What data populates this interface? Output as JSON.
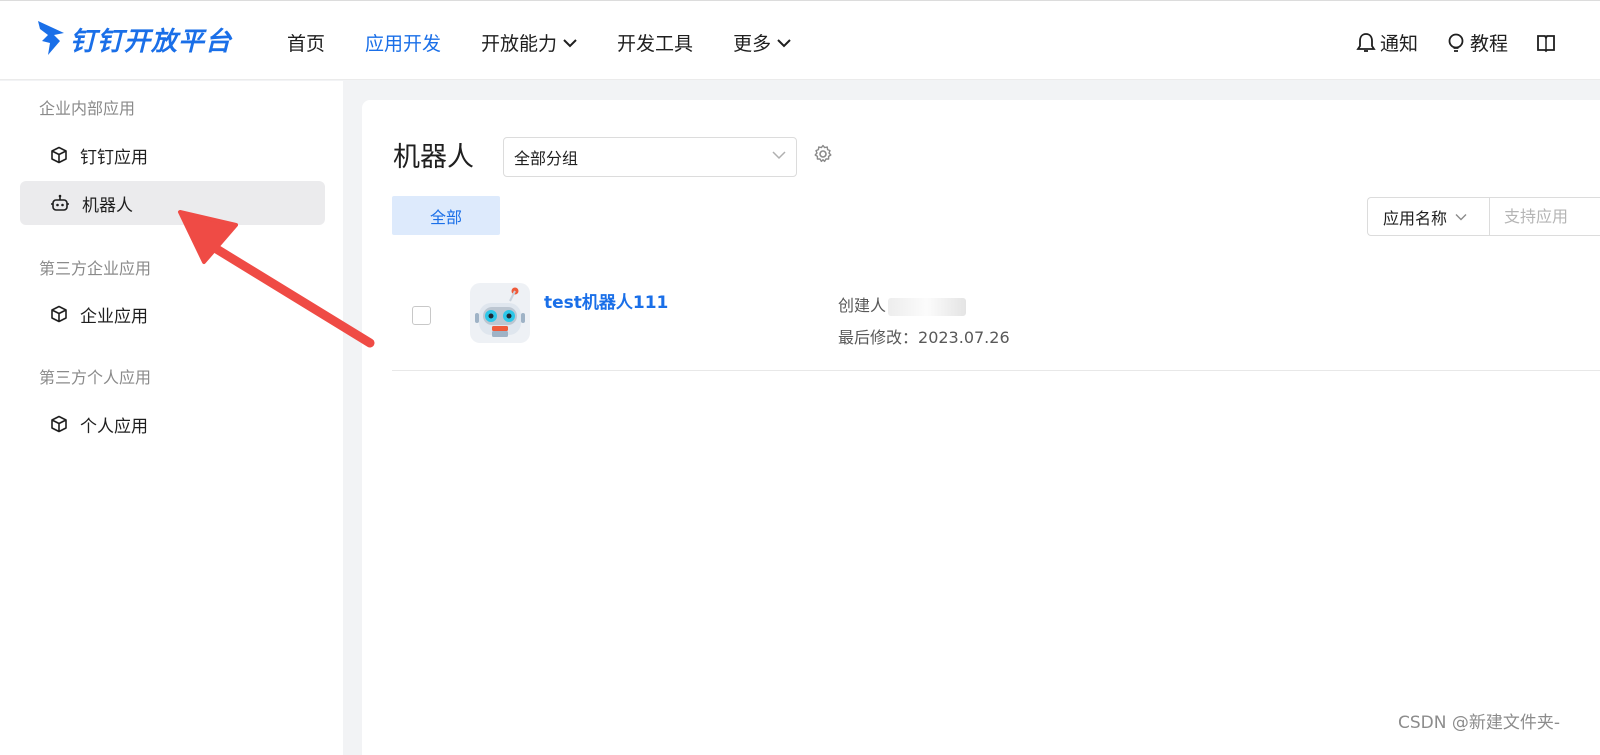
{
  "header": {
    "logo_text": "钉钉开放平台",
    "nav": [
      {
        "label": "首页",
        "active": false,
        "dropdown": false
      },
      {
        "label": "应用开发",
        "active": true,
        "dropdown": false
      },
      {
        "label": "开放能力",
        "active": false,
        "dropdown": true
      },
      {
        "label": "开发工具",
        "active": false,
        "dropdown": false
      },
      {
        "label": "更多",
        "active": false,
        "dropdown": true
      }
    ],
    "right": {
      "notify_label": "通知",
      "notify_icon": "bell-icon",
      "tutorial_label": "教程",
      "tutorial_icon": "lightbulb-icon",
      "docs_icon": "book-icon"
    }
  },
  "sidebar": {
    "groups": [
      {
        "title": "企业内部应用",
        "items": [
          {
            "label": "钉钉应用",
            "icon": "cube-icon",
            "active": false
          },
          {
            "label": "机器人",
            "icon": "robot-icon",
            "active": true
          }
        ]
      },
      {
        "title": "第三方企业应用",
        "items": [
          {
            "label": "企业应用",
            "icon": "cube-icon",
            "active": false
          }
        ]
      },
      {
        "title": "第三方个人应用",
        "items": [
          {
            "label": "个人应用",
            "icon": "cube-icon",
            "active": false
          }
        ]
      }
    ]
  },
  "main": {
    "title": "机器人",
    "group_select": {
      "value": "全部分组"
    },
    "tabs": [
      {
        "label": "全部",
        "active": true
      }
    ],
    "search": {
      "type_label": "应用名称",
      "placeholder": "支持应用"
    },
    "apps": [
      {
        "name": "test机器人111",
        "creator_label": "创建人",
        "modified_label": "最后修改：",
        "modified_value": "2023.07.26"
      }
    ]
  },
  "watermark": "CSDN @新建文件夹-",
  "colors": {
    "accent": "#1a6fe8",
    "active_bg": "#ebebed",
    "tab_bg": "#ddeafc",
    "arrow": "#ef4b45"
  }
}
